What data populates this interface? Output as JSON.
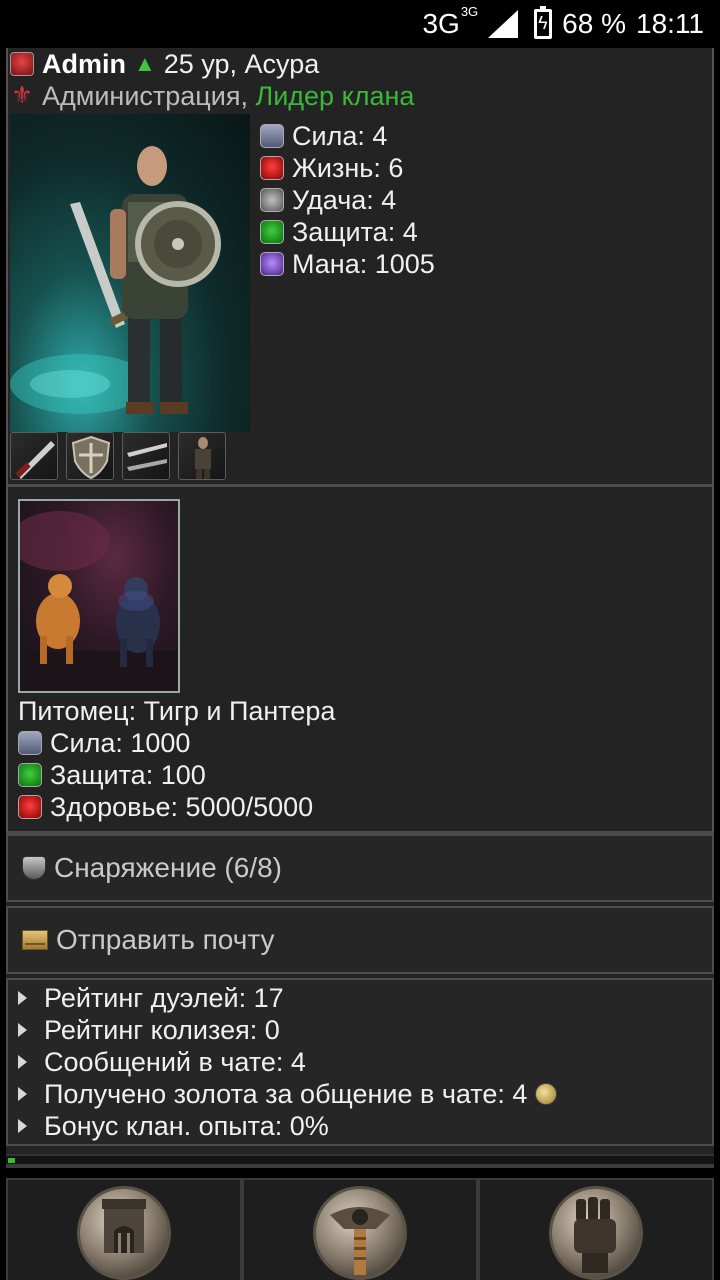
{
  "status_bar": {
    "network": "3G",
    "network_sup": "3G",
    "battery": "68 %",
    "time": "18:11"
  },
  "profile": {
    "username": "Admin",
    "level_race": "25 ур, Асура",
    "group": "Администрация",
    "clan_role": "Лидер клана",
    "stats": [
      {
        "label": "Сила: 4",
        "icon": "power-icon"
      },
      {
        "label": "Жизнь: 6",
        "icon": "life-icon"
      },
      {
        "label": "Удача: 4",
        "icon": "luck-icon"
      },
      {
        "label": "Защита: 4",
        "icon": "defense-icon"
      },
      {
        "label": "Мана: 1005",
        "icon": "mana-icon"
      }
    ],
    "equipment_icons": [
      "sword-icon",
      "shield-icon",
      "blades-icon",
      "armor-icon"
    ]
  },
  "pet": {
    "name": "Питомец: Тигр и Пантера",
    "stats": [
      {
        "label": "Сила: 1000",
        "icon": "power-icon"
      },
      {
        "label": "Защита: 100",
        "icon": "defense-icon"
      },
      {
        "label": "Здоровье: 5000/5000",
        "icon": "life-icon"
      }
    ]
  },
  "sections": {
    "equipment": "Снаряжение (6/8)",
    "mail": "Отправить почту"
  },
  "info": [
    "Рейтинг дуэлей: 17",
    "Рейтинг колизея: 0",
    "Сообщений в чате: 4",
    "Получено золота за общение в чате: 4",
    "Бонус клан. опыта: 0%"
  ],
  "progress": 0.01,
  "nav": [
    "castle-icon",
    "sword-emblem-icon",
    "fist-icon"
  ]
}
